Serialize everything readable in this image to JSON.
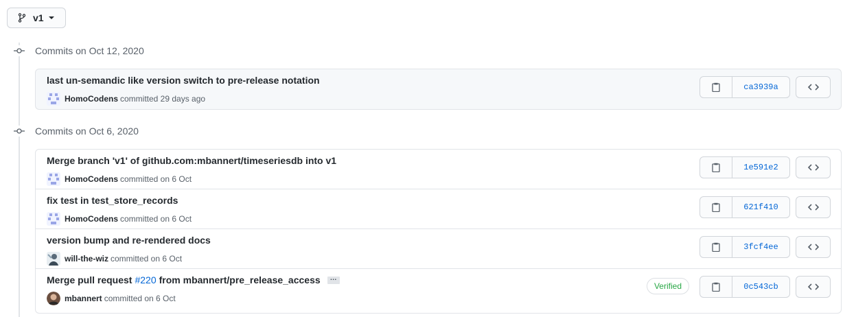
{
  "branch": {
    "label": "v1"
  },
  "groups": [
    {
      "header": "Commits on Oct 12, 2020",
      "commits": [
        {
          "message": "last un-semandic like version switch to pre-release notation",
          "author": "HomoCodens",
          "date_text": "committed 29 days ago",
          "sha": "ca3939a"
        }
      ]
    },
    {
      "header": "Commits on Oct 6, 2020",
      "commits": [
        {
          "message": "Merge branch 'v1' of github.com:mbannert/timeseriesdb into v1",
          "author": "HomoCodens",
          "date_text": "committed on 6 Oct",
          "sha": "1e591e2"
        },
        {
          "message": "fix test in test_store_records",
          "author": "HomoCodens",
          "date_text": "committed on 6 Oct",
          "sha": "621f410"
        },
        {
          "message": "version bump and re-rendered docs",
          "author": "will-the-wiz",
          "date_text": "committed on 6 Oct",
          "sha": "3fcf4ee"
        },
        {
          "message_prefix": "Merge pull request",
          "pr_link": "#220",
          "message_suffix": "from mbannert/pre_release_access",
          "ellipsis": "…",
          "author": "mbannert",
          "date_text": "committed on 6 Oct",
          "verified": "Verified",
          "sha": "0c543cb"
        }
      ]
    }
  ],
  "colors": {
    "link": "#0366d6",
    "verified": "#28a745",
    "border": "#e1e4e8"
  },
  "icons": {
    "branch": "git-branch-icon",
    "commit": "git-commit-icon",
    "copy": "clipboard-icon",
    "browse": "code-icon"
  }
}
